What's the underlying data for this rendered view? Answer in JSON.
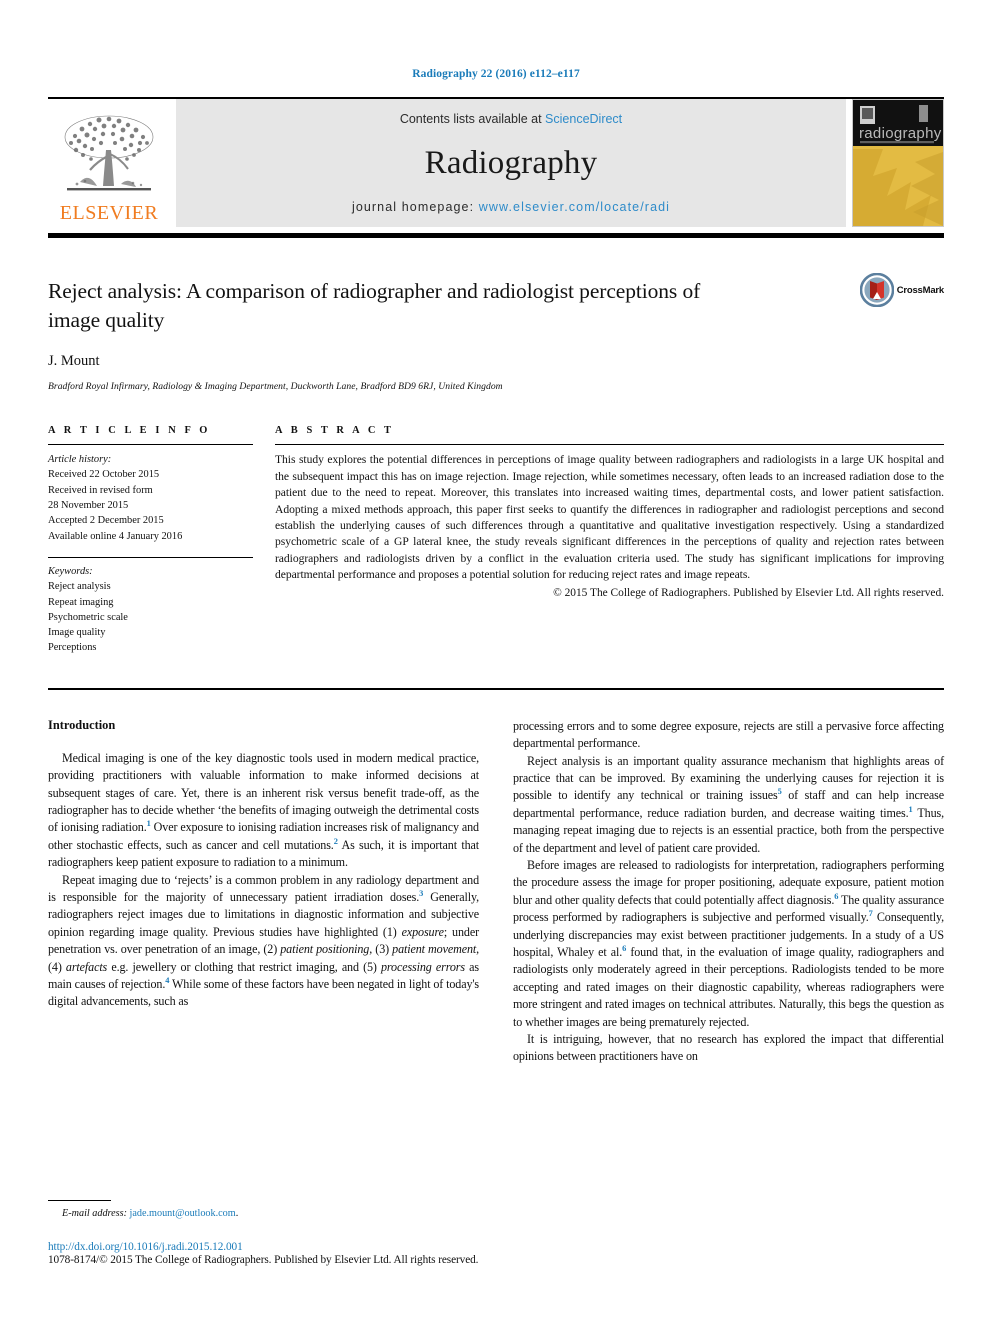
{
  "running_head": "Radiography 22 (2016) e112–e117",
  "masthead": {
    "publisher_name": "ELSEVIER",
    "contents_prefix": "Contents lists available at ",
    "contents_link": "ScienceDirect",
    "journal_title": "Radiography",
    "homepage_prefix": "journal homepage: ",
    "homepage_url": "www.elsevier.com/locate/radi",
    "cover_title": "radiography",
    "cover_subtitle": "INTERNATIONAL JOURNAL OF DIAGNOSTIC IMAGING AND RADIATION THERAPY"
  },
  "article": {
    "title": "Reject analysis: A comparison of radiographer and radiologist perceptions of image quality",
    "author": "J. Mount",
    "affiliation": "Bradford Royal Infirmary, Radiology & Imaging Department, Duckworth Lane, Bradford BD9 6RJ, United Kingdom",
    "crossmark_label": "CrossMark"
  },
  "article_info": {
    "heading": "A R T I C L E  I N F O",
    "history_label": "Article history:",
    "history": [
      "Received 22 October 2015",
      "Received in revised form",
      "28 November 2015",
      "Accepted 2 December 2015",
      "Available online 4 January 2016"
    ],
    "keywords_label": "Keywords:",
    "keywords": [
      "Reject analysis",
      "Repeat imaging",
      "Psychometric scale",
      "Image quality",
      "Perceptions"
    ]
  },
  "abstract": {
    "heading": "A B S T R A C T",
    "text": "This study explores the potential differences in perceptions of image quality between radiographers and radiologists in a large UK hospital and the subsequent impact this has on image rejection. Image rejection, while sometimes necessary, often leads to an increased radiation dose to the patient due to the need to repeat. Moreover, this translates into increased waiting times, departmental costs, and lower patient satisfaction. Adopting a mixed methods approach, this paper first seeks to quantify the differences in radiographer and radiologist perceptions and second establish the underlying causes of such differences through a quantitative and qualitative investigation respectively. Using a standardized psychometric scale of a GP lateral knee, the study reveals significant differences in the perceptions of quality and rejection rates between radiographers and radiologists driven by a conflict in the evaluation criteria used. The study has significant implications for improving departmental performance and proposes a potential solution for reducing reject rates and image repeats.",
    "copyright": "© 2015 The College of Radiographers. Published by Elsevier Ltd. All rights reserved."
  },
  "body": {
    "intro_heading": "Introduction",
    "left_paragraphs": [
      {
        "parts": [
          {
            "t": "Medical imaging is one of the key diagnostic tools used in modern medical practice, providing practitioners with valuable information to make informed decisions at subsequent stages of care. Yet, there is an inherent risk versus benefit trade-off, as the radiographer has to decide whether ‘the benefits of imaging outweigh the detrimental costs of ionising radiation."
          },
          {
            "t": "1",
            "ref": true
          },
          {
            "t": " Over exposure to ionising radiation increases risk of malignancy and other stochastic effects, such as cancer and cell mutations."
          },
          {
            "t": "2",
            "ref": true
          },
          {
            "t": " As such, it is important that radiographers keep patient exposure to radiation to a minimum."
          }
        ]
      },
      {
        "parts": [
          {
            "t": "Repeat imaging due to ‘rejects’ is a common problem in any radiology department and is responsible for the majority of unnecessary patient irradiation doses."
          },
          {
            "t": "3",
            "ref": true
          },
          {
            "t": " Generally, radiographers reject images due to limitations in diagnostic information and subjective opinion regarding image quality. Previous studies have highlighted (1) "
          },
          {
            "t": "exposure",
            "em": true
          },
          {
            "t": "; under penetration vs. over penetration of an image, (2) "
          },
          {
            "t": "patient positioning",
            "em": true
          },
          {
            "t": ", (3) "
          },
          {
            "t": "patient movement",
            "em": true
          },
          {
            "t": ", (4) "
          },
          {
            "t": "artefacts",
            "em": true
          },
          {
            "t": " e.g. jewellery or clothing that restrict imaging, and (5) "
          },
          {
            "t": "processing errors",
            "em": true
          },
          {
            "t": " as main causes of rejection."
          },
          {
            "t": "4",
            "ref": true
          },
          {
            "t": " While some of these factors have been negated in light of today's digital advancements, such as"
          }
        ]
      }
    ],
    "right_paragraphs": [
      {
        "noindent": true,
        "parts": [
          {
            "t": "processing errors and to some degree exposure, rejects are still a pervasive force affecting departmental performance."
          }
        ]
      },
      {
        "parts": [
          {
            "t": "Reject analysis is an important quality assurance mechanism that highlights areas of practice that can be improved. By examining the underlying causes for rejection it is possible to identify any technical or training issues"
          },
          {
            "t": "5",
            "ref": true
          },
          {
            "t": " of staff and can help increase departmental performance, reduce radiation burden, and decrease waiting times."
          },
          {
            "t": "1",
            "ref": true
          },
          {
            "t": " Thus, managing repeat imaging due to rejects is an essential practice, both from the perspective of the department and level of patient care provided."
          }
        ]
      },
      {
        "parts": [
          {
            "t": "Before images are released to radiologists for interpretation, radiographers performing the procedure assess the image for proper positioning, adequate exposure, patient motion blur and other quality defects that could potentially affect diagnosis."
          },
          {
            "t": "6",
            "ref": true
          },
          {
            "t": " The quality assurance process performed by radiographers is subjective and performed visually."
          },
          {
            "t": "7",
            "ref": true
          },
          {
            "t": " Consequently, underlying discrepancies may exist between practitioner judgements. In a study of a US hospital, Whaley et al."
          },
          {
            "t": "6",
            "ref": true
          },
          {
            "t": " found that, in the evaluation of image quality, radiographers and radiologists only moderately agreed in their perceptions. Radiologists tended to be more accepting and rated images on their diagnostic capability, whereas radiographers were more stringent and rated images on technical attributes. Naturally, this begs the question as to whether images are being prematurely rejected."
          }
        ]
      },
      {
        "parts": [
          {
            "t": "It is intriguing, however, that no research has explored the impact that differential opinions between practitioners have on"
          }
        ]
      }
    ]
  },
  "footer": {
    "email_label": "E-mail address:",
    "email_address": "jade.mount@outlook.com",
    "email_trailing": ".",
    "doi": "http://dx.doi.org/10.1016/j.radi.2015.12.001",
    "copyright": "1078-8174/© 2015 The College of Radiographers. Published by Elsevier Ltd. All rights reserved."
  },
  "colors": {
    "link_blue": "#1a7bb9",
    "sciencedirect_blue": "#2e8bc9",
    "elsevier_orange": "#f07c20",
    "cover_gold": "#e0b43a",
    "crossmark_red": "#c4211a"
  }
}
